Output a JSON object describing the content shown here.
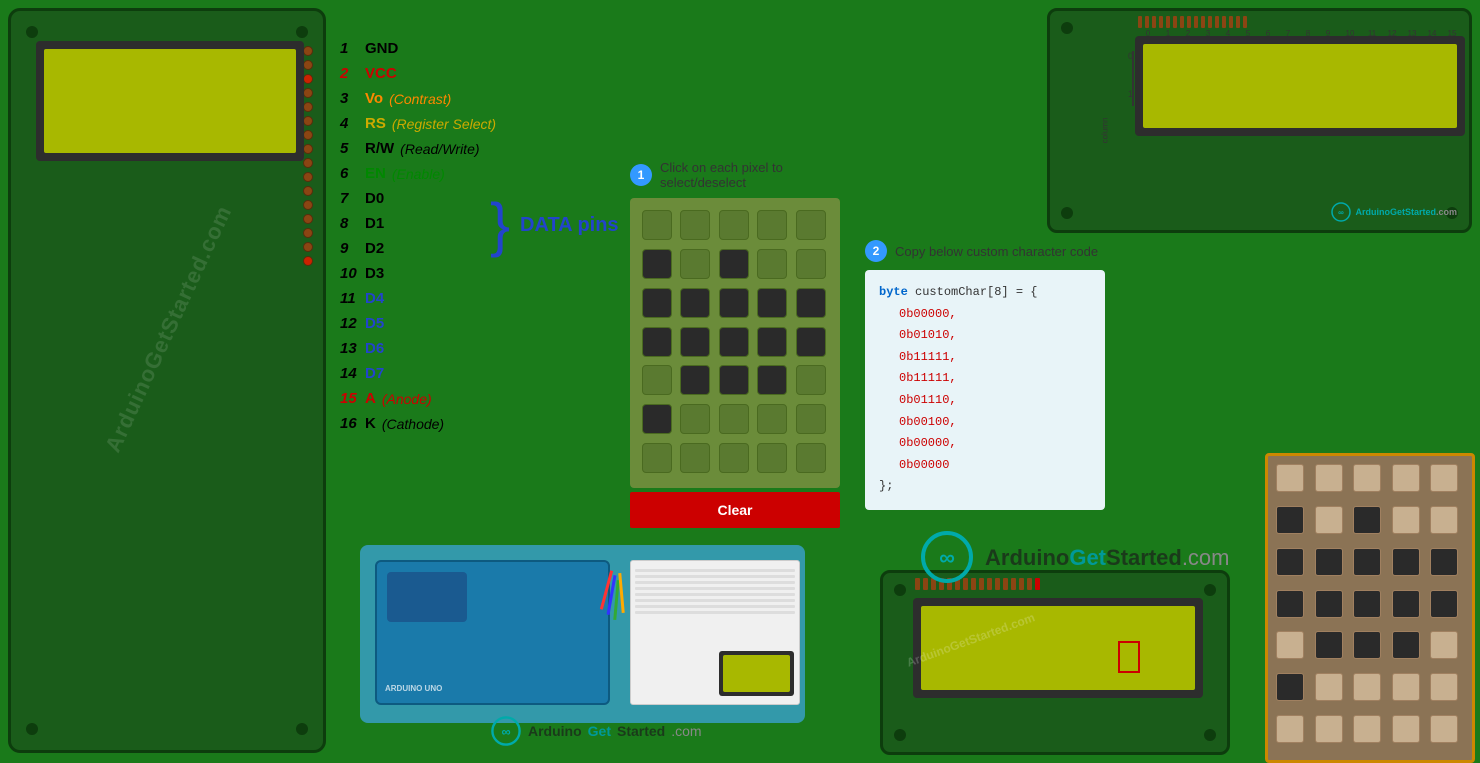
{
  "page": {
    "background": "#1a7a1a"
  },
  "pins": [
    {
      "num": "1",
      "name": "GND",
      "desc": "",
      "color": "black",
      "numColor": "black"
    },
    {
      "num": "2",
      "name": "VCC",
      "desc": "",
      "color": "red",
      "numColor": "red"
    },
    {
      "num": "3",
      "name": "Vo",
      "desc": "(Contrast)",
      "color": "orange",
      "numColor": "black"
    },
    {
      "num": "4",
      "name": "RS",
      "desc": "(Register Select)",
      "color": "yellow",
      "numColor": "black"
    },
    {
      "num": "5",
      "name": "R/W",
      "desc": "(Read/Write)",
      "color": "black",
      "numColor": "black"
    },
    {
      "num": "6",
      "name": "EN",
      "desc": "(Enable)",
      "color": "green",
      "numColor": "black"
    },
    {
      "num": "7",
      "name": "D0",
      "desc": "",
      "color": "black",
      "numColor": "black"
    },
    {
      "num": "8",
      "name": "D1",
      "desc": "",
      "color": "black",
      "numColor": "black"
    },
    {
      "num": "9",
      "name": "D2",
      "desc": "",
      "color": "black",
      "numColor": "black"
    },
    {
      "num": "10",
      "name": "D3",
      "desc": "",
      "color": "black",
      "numColor": "black"
    },
    {
      "num": "11",
      "name": "D4",
      "desc": "",
      "color": "blue",
      "numColor": "black"
    },
    {
      "num": "12",
      "name": "D5",
      "desc": "",
      "color": "blue",
      "numColor": "black"
    },
    {
      "num": "13",
      "name": "D6",
      "desc": "",
      "color": "blue",
      "numColor": "black"
    },
    {
      "num": "14",
      "name": "D7",
      "desc": "",
      "color": "blue",
      "numColor": "black"
    },
    {
      "num": "15",
      "name": "A",
      "desc": "(Anode)",
      "color": "red",
      "numColor": "red"
    },
    {
      "num": "16",
      "name": "K",
      "desc": "(Cathode)",
      "color": "black",
      "numColor": "black"
    }
  ],
  "data_pins_label": "DATA pins",
  "pixel_grid": {
    "instruction": "Click on each pixel to select/deselect",
    "step": "1",
    "clear_btn": "Clear",
    "rows": 7,
    "cols": 5,
    "active_cells": [
      5,
      7,
      10,
      11,
      12,
      13,
      14,
      15,
      16,
      17,
      18,
      19,
      21,
      22,
      23,
      25
    ]
  },
  "code_section": {
    "step": "2",
    "instruction": "Copy below custom character code",
    "lines": [
      "byte customChar[8] = {",
      "    0b00000,",
      "    0b01010,",
      "    0b11111,",
      "    0b11111,",
      "    0b01110,",
      "    0b00100,",
      "    0b00000,",
      "    0b00000"
    ],
    "closing": "};"
  },
  "top_right_lcd": {
    "col_labels": [
      "0",
      "1",
      "2",
      "3",
      "4",
      "5",
      "6",
      "7",
      "8",
      "9",
      "10",
      "11",
      "12",
      "13",
      "14",
      "15"
    ],
    "row_label": "row",
    "col_label": "column",
    "row_nums": [
      "0",
      "1"
    ],
    "logo": "ArduinoGetStarted.com"
  },
  "logo_bottom": {
    "text_arduino": "Arduino",
    "text_get": "Get",
    "text_started": "Started",
    "text_com": ".com"
  },
  "logo_right": {
    "text": "ArduinoGetStarted",
    "com": ".com"
  },
  "watermark": "ArduinoGetStarted.com"
}
